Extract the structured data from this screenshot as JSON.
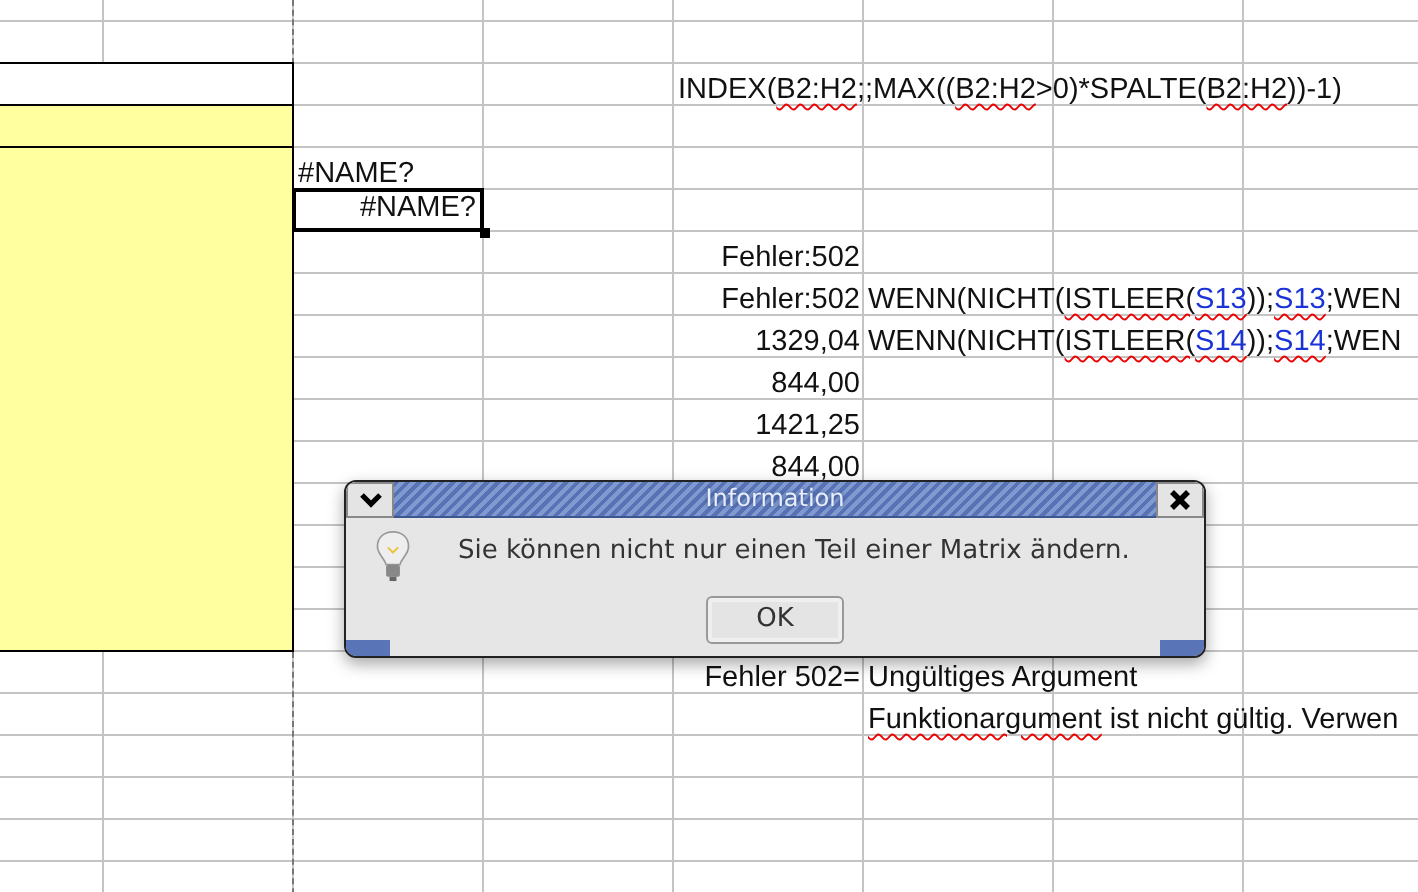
{
  "sheet": {
    "rows": [
      {},
      {},
      {
        "column_5": {
          "kind": "text",
          "selected": false,
          "parts": [
            {
              "kind": "plain",
              "text": "INDEX("
            },
            {
              "kind": "spell",
              "text": "B2:H2"
            },
            {
              "kind": "plain",
              "text": ";;MAX(("
            },
            {
              "kind": "spell",
              "text": "B2:H2"
            },
            {
              "kind": "plain",
              "text": ">0)*SPALTE("
            },
            {
              "kind": "spell",
              "text": "B2:H2"
            },
            {
              "kind": "plain",
              "text": "))-1)"
            }
          ]
        }
      },
      {},
      {
        "column_3": {
          "kind": "text",
          "selected": false,
          "text": "#NAME?"
        }
      },
      {
        "column_3": {
          "kind": "value",
          "selected": true,
          "text": "#NAME?"
        }
      },
      {
        "column_5": {
          "kind": "value",
          "selected": false,
          "text": "Fehler:502"
        }
      },
      {
        "column_5": {
          "kind": "value",
          "selected": false,
          "text": "Fehler:502"
        },
        "column_6": {
          "kind": "text",
          "selected": false,
          "parts": [
            {
              "kind": "plain",
              "text": "WENN(NICHT("
            },
            {
              "kind": "spell",
              "text": "ISTLEER("
            },
            {
              "kind": "ref",
              "text": "S13"
            },
            {
              "kind": "plain",
              "text": "));"
            },
            {
              "kind": "ref",
              "text": "S13"
            },
            {
              "kind": "plain",
              "text": ";WEN"
            }
          ]
        }
      },
      {
        "column_5": {
          "kind": "value",
          "selected": false,
          "text": "1329,04"
        },
        "column_6": {
          "kind": "text",
          "selected": false,
          "parts": [
            {
              "kind": "plain",
              "text": "WENN(NICHT("
            },
            {
              "kind": "spell",
              "text": "ISTLEER("
            },
            {
              "kind": "ref",
              "text": "S14"
            },
            {
              "kind": "plain",
              "text": "));"
            },
            {
              "kind": "ref",
              "text": "S14"
            },
            {
              "kind": "plain",
              "text": ";WEN"
            }
          ]
        }
      },
      {
        "column_5": {
          "kind": "value",
          "selected": false,
          "text": "844,00"
        }
      },
      {
        "column_5": {
          "kind": "value",
          "selected": false,
          "text": "1421,25"
        }
      },
      {
        "column_5": {
          "kind": "value",
          "selected": false,
          "text": "844,00"
        }
      },
      {},
      {},
      {},
      {},
      {
        "column_5": {
          "kind": "value",
          "selected": false,
          "text": "Fehler 502="
        },
        "column_6": {
          "kind": "text",
          "selected": false,
          "text": "Ungültiges Argument"
        }
      },
      {
        "column_6": {
          "kind": "text",
          "selected": false,
          "parts": [
            {
              "kind": "spell",
              "text": "Funktionargument"
            },
            {
              "kind": "plain",
              "text": " ist nicht gültig. Verwen"
            }
          ]
        }
      },
      {},
      {},
      {},
      {}
    ]
  },
  "dialog": {
    "title": "Information",
    "message": "Sie können nicht nur einen Teil einer Matrix ändern.",
    "buttons": [
      "OK"
    ]
  }
}
